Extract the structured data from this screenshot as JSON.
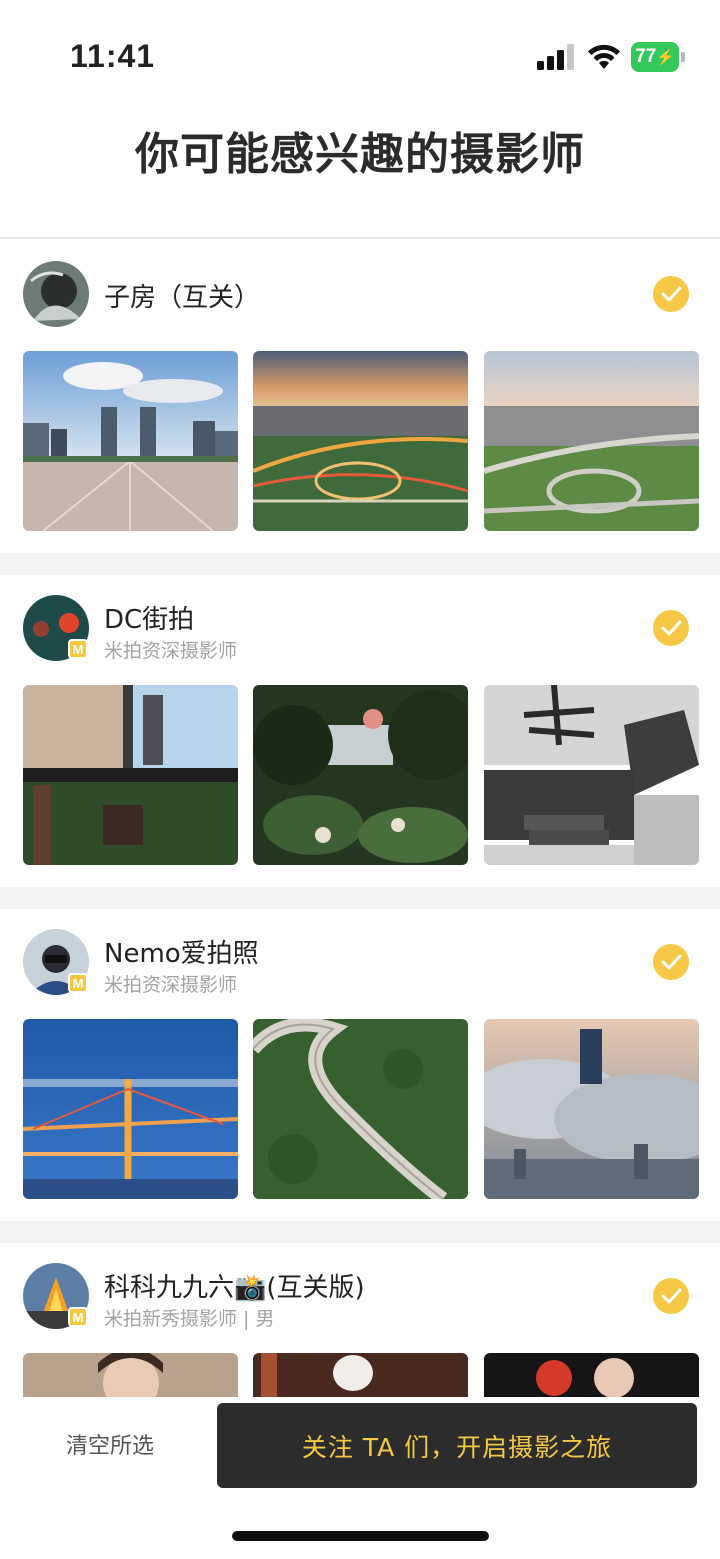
{
  "status_bar": {
    "time": "11:41",
    "battery": "77"
  },
  "page": {
    "title": "你可能感兴趣的摄影师"
  },
  "photographers": [
    {
      "name": "子房（互关）",
      "subtitle": "",
      "selected": true
    },
    {
      "name": "DC街拍",
      "subtitle": "米拍资深摄影师",
      "selected": true
    },
    {
      "name": "Nemo爱拍照",
      "subtitle": "米拍资深摄影师",
      "selected": true
    },
    {
      "name": "科科九九六📸(互关版)",
      "subtitle": "米拍新秀摄影师 | 男",
      "selected": true
    }
  ],
  "bottom_bar": {
    "clear_label": "清空所选",
    "follow_label": "关注 TA 们，开启摄影之旅"
  },
  "colors": {
    "accent": "#f6c846",
    "button_bg": "#2c2c2c",
    "button_text": "#f3c945"
  }
}
